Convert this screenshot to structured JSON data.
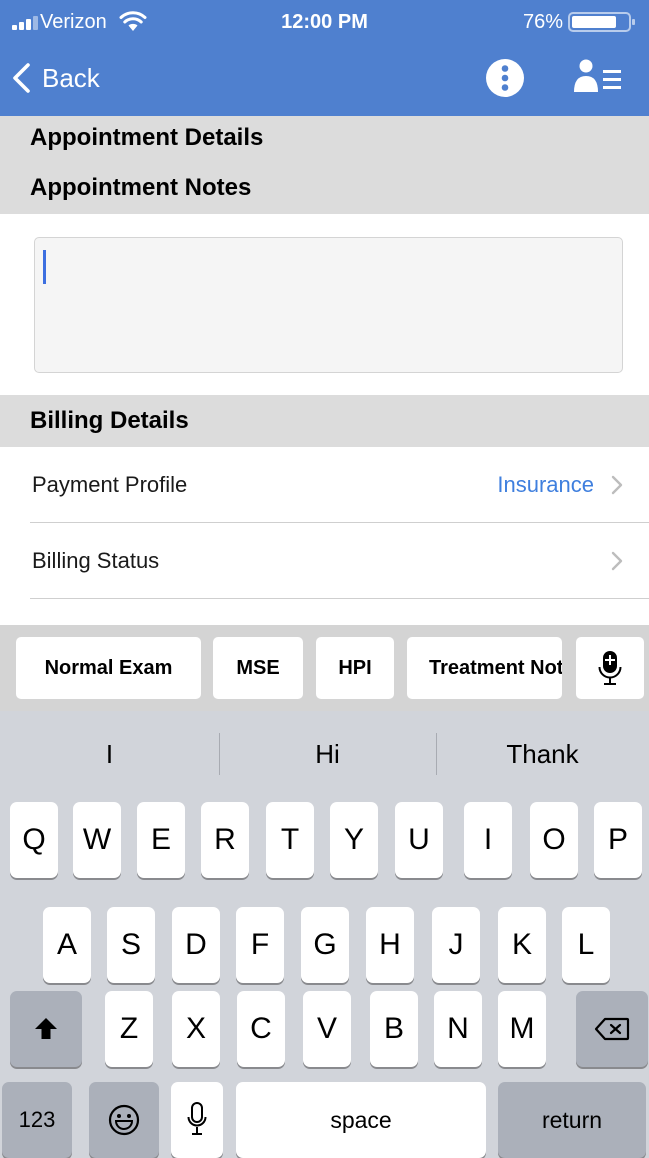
{
  "status_bar": {
    "carrier": "Verizon",
    "time": "12:00 PM",
    "battery_percent": "76%"
  },
  "nav": {
    "back_label": "Back"
  },
  "appointment": {
    "title_details": "Appointment Details",
    "title_notes": "Appointment Notes",
    "notes_value": ""
  },
  "billing": {
    "title": "Billing Details",
    "payment_profile_label": "Payment Profile",
    "payment_profile_value": "Insurance",
    "billing_status_label": "Billing Status"
  },
  "toolbar": {
    "buttons": [
      "Normal Exam",
      "MSE",
      "HPI",
      "Treatment Notes"
    ]
  },
  "keyboard": {
    "suggestions": [
      "I",
      "Hi",
      "Thank"
    ],
    "row1": [
      "Q",
      "W",
      "E",
      "R",
      "T",
      "Y",
      "U",
      "I",
      "O",
      "P"
    ],
    "row2": [
      "A",
      "S",
      "D",
      "F",
      "G",
      "H",
      "J",
      "K",
      "L"
    ],
    "row3": [
      "Z",
      "X",
      "C",
      "V",
      "B",
      "N",
      "M"
    ],
    "numbers_label": "123",
    "space_label": "space",
    "return_label": "return"
  },
  "colors": {
    "nav_blue": "#4f80cf",
    "link_blue": "#3f7fde",
    "section_gray": "#dcdcdc",
    "keyboard_bg": "#d1d4da"
  }
}
